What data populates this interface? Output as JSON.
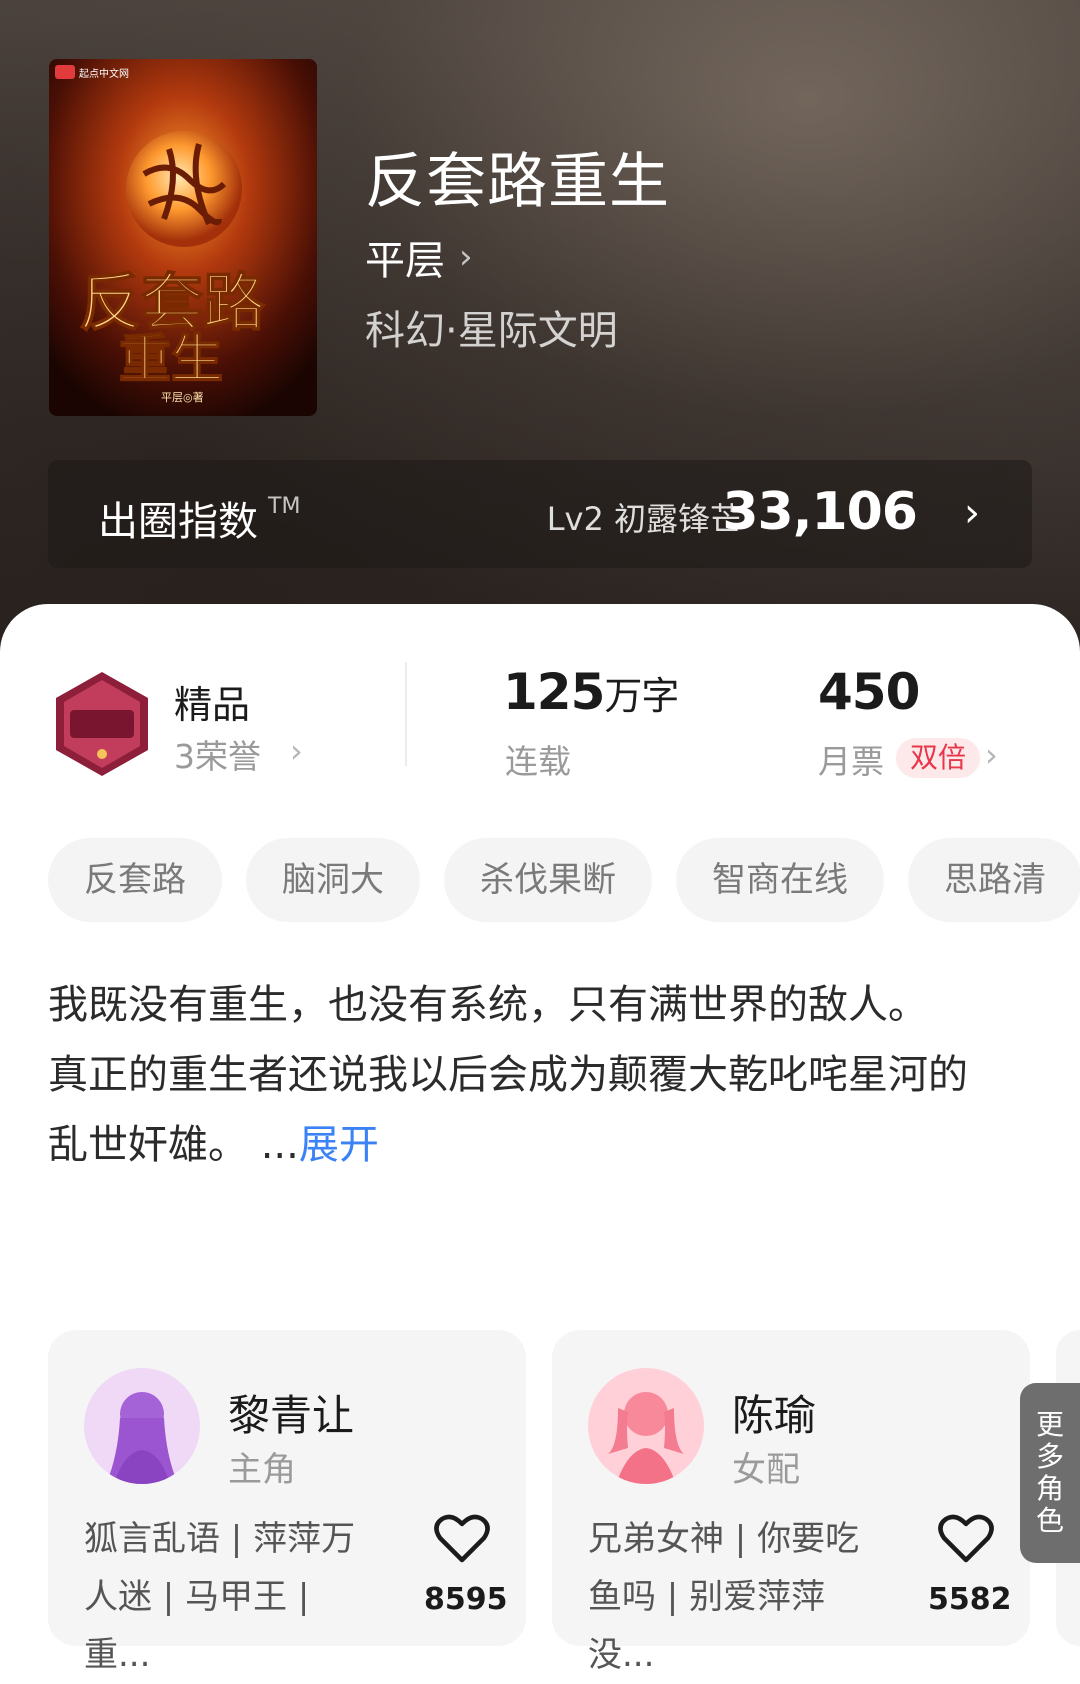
{
  "book": {
    "title": "反套路重生",
    "author": "平层",
    "genre": "科幻·星际文明",
    "cover": {
      "publisher": "起点中文网",
      "title_line1": "反套路",
      "title_line2": "重生",
      "author_credit": "平层◎著"
    }
  },
  "popularity_index": {
    "label": "出圈指数",
    "tm": "TM",
    "level": "Lv2 初露锋芒",
    "value": "33,106"
  },
  "stats": {
    "honor_title": "精品",
    "honor_sub": "3荣誉",
    "words": "125",
    "words_unit": "万字",
    "status": "连载",
    "monthly_votes": "450",
    "monthly_votes_label": "月票",
    "double_badge": "双倍"
  },
  "tags": [
    "反套路",
    "脑洞大",
    "杀伐果断",
    "智商在线",
    "思路清"
  ],
  "description": {
    "para1": "我既没有重生，也没有系统，只有满世界的敌人。",
    "para2": "真正的重生者还说我以后会成为颠覆大乾叱咤星河的乱世奸雄。",
    "ellipsis": " ...",
    "expand": "展开"
  },
  "roles": [
    {
      "name": "黎青让",
      "type": "主角",
      "desc": "狐言乱语 | 萍萍万人迷 | 马甲王 | 重...",
      "likes": "8595"
    },
    {
      "name": "陈瑜",
      "type": "女配",
      "desc": "兄弟女神 | 你要吃鱼吗 | 别爱萍萍没...",
      "likes": "5582"
    }
  ],
  "more_roles": "更多角色"
}
